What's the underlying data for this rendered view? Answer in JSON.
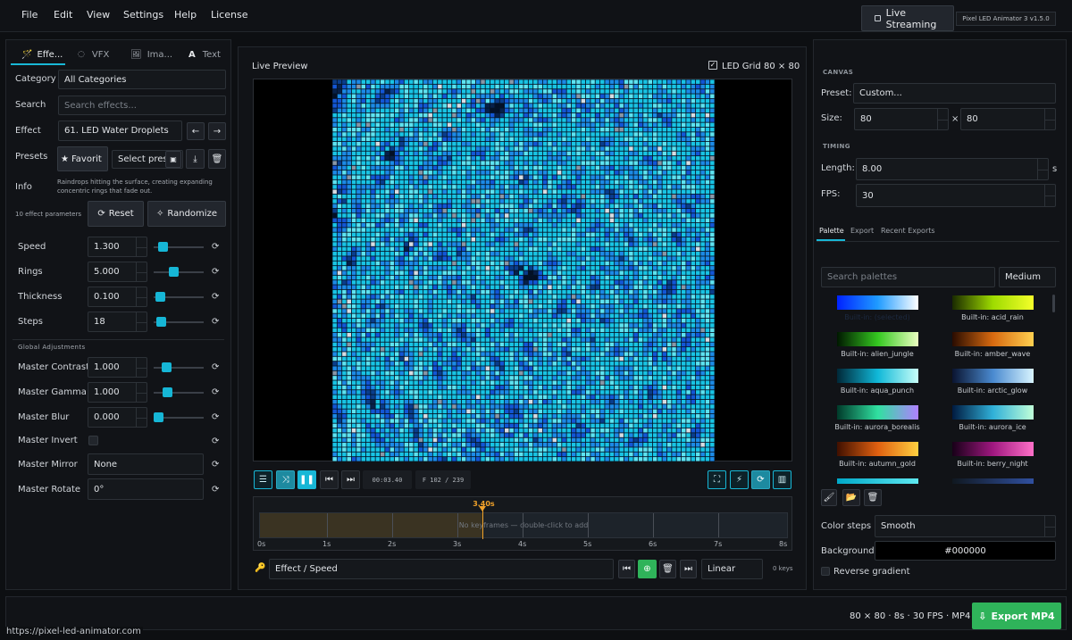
{
  "menu": [
    "File",
    "Edit",
    "View",
    "Settings",
    "Help",
    "License"
  ],
  "header": {
    "live_streaming": "Live Streaming",
    "version_badge": "Pixel LED Animator 3  v1.5.0"
  },
  "left_tabs": [
    "Effe...",
    "VFX",
    "Ima...",
    "Text"
  ],
  "effects": {
    "category_label": "Category",
    "category_value": "All Categories",
    "search_label": "Search",
    "search_placeholder": "Search effects...",
    "effect_label": "Effect",
    "effect_value": "61. LED Water Droplets",
    "presets_label": "Presets",
    "favorite": "Favorit",
    "select_preset": "Select prese",
    "info_label": "Info",
    "info_text": "Raindrops hitting the surface, creating expanding concentric rings that fade out.",
    "param_count": "10 effect parameters",
    "reset": "Reset",
    "randomize": "Randomize",
    "params": [
      {
        "name": "Speed",
        "value": "1.300",
        "level": 0.1
      },
      {
        "name": "Rings",
        "value": "5.000",
        "level": 0.38
      },
      {
        "name": "Thickness",
        "value": "0.100",
        "level": 0.05
      },
      {
        "name": "Steps",
        "value": "18",
        "level": 0.07
      }
    ],
    "global_title": "Global Adjustments",
    "global": [
      {
        "name": "Master Contrast",
        "value": "1.000",
        "level": 0.2
      },
      {
        "name": "Master Gamma",
        "value": "1.000",
        "level": 0.22
      },
      {
        "name": "Master Blur",
        "value": "0.000",
        "level": 0.0
      }
    ],
    "invert_label": "Master Invert",
    "mirror_label": "Master Mirror",
    "mirror_value": "None",
    "rotate_label": "Master Rotate",
    "rotate_value": "0°"
  },
  "preview": {
    "title": "Live Preview",
    "led_grid_label": "LED Grid",
    "grid_size": "80 × 80",
    "time": "00:03.40",
    "frame": "F 102 / 239",
    "grid_colors": [
      "#031027",
      "#07204a",
      "#0a3d8c",
      "#1356d6",
      "#1c8ae6",
      "#18c4e4",
      "#5de3f0",
      "#8a97a6",
      "#d7dde3"
    ]
  },
  "timeline": {
    "playhead_label": "3.40s",
    "playhead_time": 3.4,
    "duration": 8,
    "empty_text": "No keyframes — double-click to add",
    "ticks": [
      "0s",
      "1s",
      "2s",
      "3s",
      "4s",
      "5s",
      "6s",
      "7s",
      "8s"
    ],
    "track_name": "Effect / Speed",
    "interp": "Linear",
    "keys": "0 keys"
  },
  "right": {
    "canvas_title": "CANVAS",
    "preset_label": "Preset:",
    "preset_value": "Custom...",
    "size_label": "Size:",
    "width": "80",
    "times": "×",
    "height": "80",
    "timing_title": "TIMING",
    "length_label": "Length:",
    "length_value": "8.00",
    "length_unit": "s",
    "fps_label": "FPS:",
    "fps_value": "30",
    "tabs": [
      "Palette",
      "Export",
      "Recent Exports"
    ],
    "search_placeholder": "Search palettes",
    "size_select": "Medium",
    "palettes": [
      {
        "name": "Built-in: (selected)",
        "colors": [
          "#0022ff",
          "#1f9bff",
          "#ffffff"
        ]
      },
      {
        "name": "Built-in: acid_rain",
        "colors": [
          "#1a2a00",
          "#9edb00",
          "#f4ff2a"
        ]
      },
      {
        "name": "Built-in: alien_jungle",
        "colors": [
          "#001800",
          "#34c820",
          "#eaffc0"
        ]
      },
      {
        "name": "Built-in: amber_wave",
        "colors": [
          "#2a0c00",
          "#d86a10",
          "#ffd050"
        ]
      },
      {
        "name": "Built-in: aqua_punch",
        "colors": [
          "#002838",
          "#10b8d8",
          "#c8fff8"
        ]
      },
      {
        "name": "Built-in: arctic_glow",
        "colors": [
          "#0a1430",
          "#4a8ad0",
          "#d8f4ff"
        ]
      },
      {
        "name": "Built-in: aurora_borealis",
        "colors": [
          "#003a2a",
          "#30e0a0",
          "#b080ff"
        ]
      },
      {
        "name": "Built-in: aurora_ice",
        "colors": [
          "#001a40",
          "#30b0d8",
          "#c0ffd8"
        ]
      },
      {
        "name": "Built-in: autumn_gold",
        "colors": [
          "#401000",
          "#e06010",
          "#ffd040"
        ]
      },
      {
        "name": "Built-in: berry_night",
        "colors": [
          "#180018",
          "#a01880",
          "#ff70c8"
        ]
      }
    ],
    "color_steps_label": "Color steps",
    "color_steps_value": "Smooth",
    "background_label": "Background",
    "background_value": "#000000",
    "reverse_label": "Reverse gradient"
  },
  "status": {
    "summary": "80 × 80  ·  8s  ·  30 FPS  ·  MP4",
    "export": "Export MP4",
    "url": "https://pixel-led-animator.com"
  }
}
